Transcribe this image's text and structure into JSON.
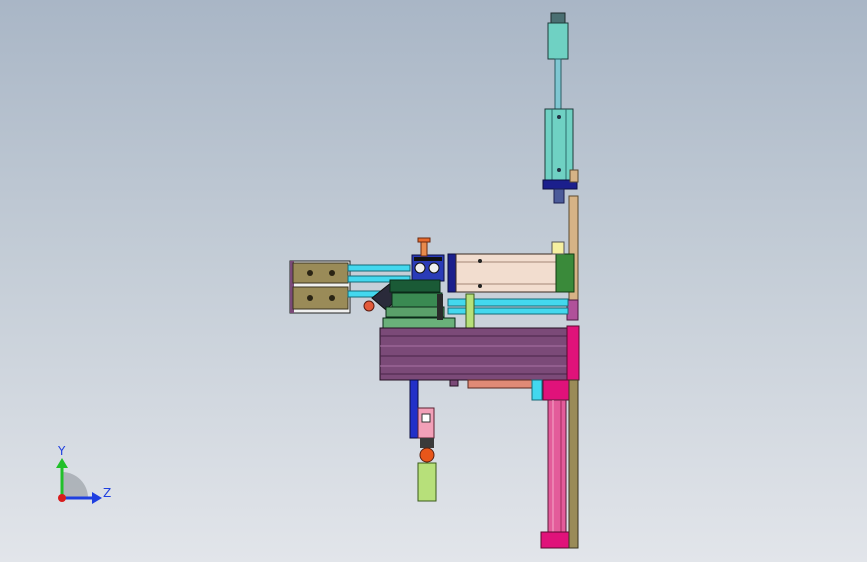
{
  "viewport": {
    "background_top": "#a9b6c6",
    "background_bottom": "#e2e5ea"
  },
  "triad": {
    "y_label": "Y",
    "z_label": "Z",
    "y_color": "#21c02a",
    "z_color": "#1f3fe0",
    "origin_color": "#d81c1c"
  },
  "colors": {
    "cyan_body": "#6fd1c3",
    "cyan_rail": "#43d8ee",
    "navy": "#1b1f8c",
    "purple_body": "#7b4a78",
    "magenta": "#e0127a",
    "pink_rod": "#e35c9a",
    "tan": "#d6b386",
    "cream": "#f2ddcf",
    "olive": "#9a8b58",
    "green": "#3a8a52",
    "lime": "#b7e07a",
    "salmon": "#e08a76"
  }
}
